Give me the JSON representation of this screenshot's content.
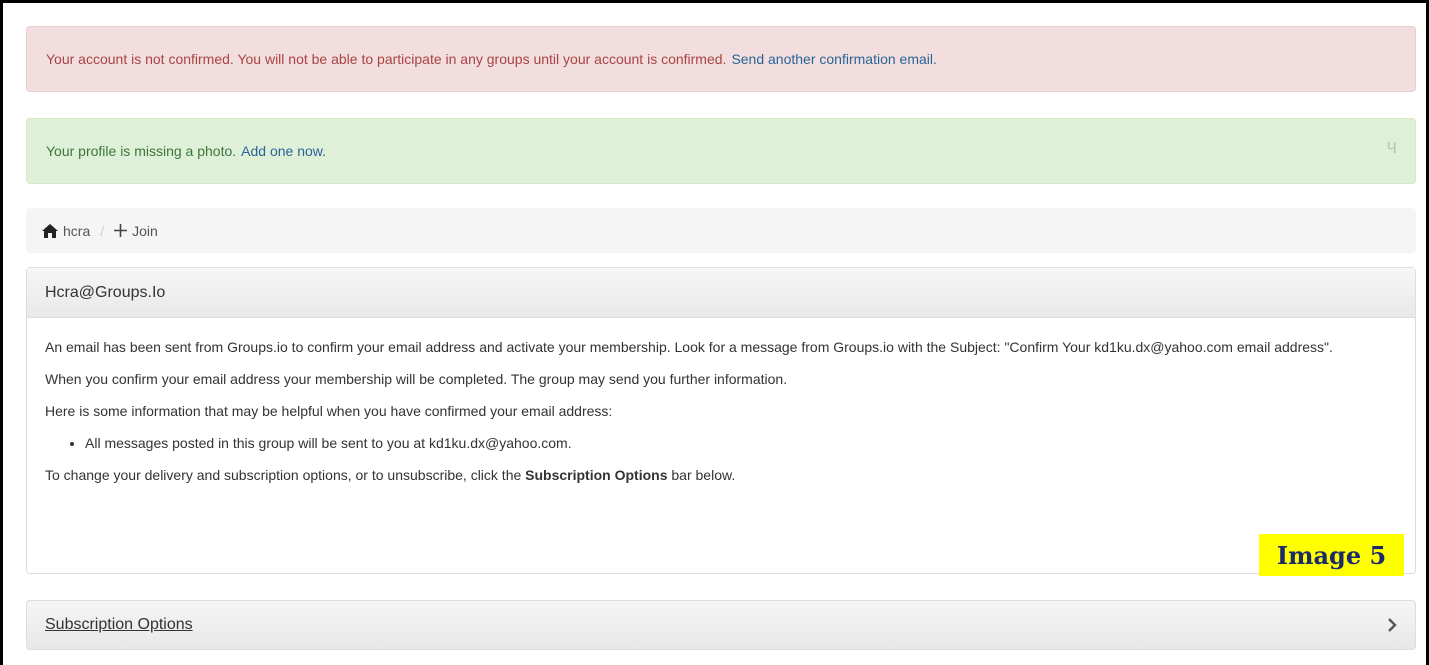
{
  "alerts": {
    "not_confirmed": {
      "text": "Your account is not confirmed. You will not be able to participate in any groups until your account is confirmed.",
      "link": "Send another confirmation email."
    },
    "missing_photo": {
      "text": "Your profile is missing a photo.",
      "link": "Add one now.",
      "close_glyph": "ч"
    }
  },
  "breadcrumb": {
    "home_label": "hcra",
    "join_label": "Join",
    "separator": "/"
  },
  "panel": {
    "title": "Hcra@Groups.Io",
    "para1": "An email has been sent from Groups.io to confirm your email address and activate your membership. Look for a message from Groups.io with the Subject: \"Confirm Your kd1ku.dx@yahoo.com email address\".",
    "para2": "When you confirm your email address your membership will be completed. The group may send you further information.",
    "para3": "Here is some information that may be helpful when you have confirmed your email address:",
    "bullet1": "All messages posted in this group will be sent to you at kd1ku.dx@yahoo.com.",
    "para4_before": "To change your delivery and subscription options, or to unsubscribe, click the",
    "para4_bold": "Subscription Options",
    "para4_after": "bar below."
  },
  "image_label": "Image 5",
  "subscription_bar": {
    "label": "Subscription Options"
  },
  "icons": {
    "home": "home-icon",
    "plus": "plus-icon",
    "chevron": "chevron-right-icon"
  },
  "colors": {
    "danger_bg": "#f2dede",
    "danger_text": "#a94442",
    "success_bg": "#dff0d8",
    "success_text": "#3c763d",
    "link": "#2a6496",
    "label_highlight": "#ffff00"
  }
}
